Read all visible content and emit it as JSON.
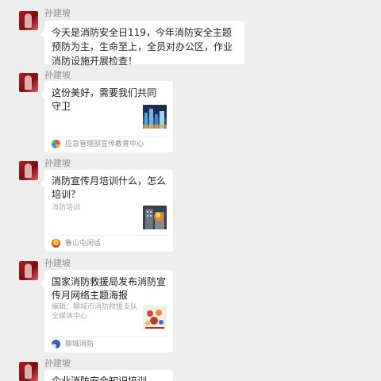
{
  "sender_name": "孙建坡",
  "messages": [
    {
      "type": "text",
      "text": "今天是消防安全日119，今年消防安全主题预防为主，生命至上，全员对办公区，作业消防设施开展检查！"
    },
    {
      "type": "card",
      "title": "这份美好，需要我们共同守卫",
      "source": "应急管理部宣传教育中心",
      "thumbnail_icon": "city-night-icon"
    },
    {
      "type": "card",
      "title": "消防宣传月培训什么，怎么培训？",
      "description": "消防培训",
      "source": "鲁山屯闲话",
      "thumbnail_icon": "fire-building-icon"
    },
    {
      "type": "card",
      "title": "国家消防救援局发布消防宣传月网络主题海报",
      "description": "编辑：聊城市消防救援支队全媒体中心",
      "source": "聊城消防",
      "thumbnail_icon": "poster-icon"
    },
    {
      "type": "card",
      "title": "企业消防安全知识培训"
    }
  ],
  "colors": {
    "background": "#ededed",
    "bubble": "#ffffff",
    "sender_name": "#8c8c8c"
  }
}
